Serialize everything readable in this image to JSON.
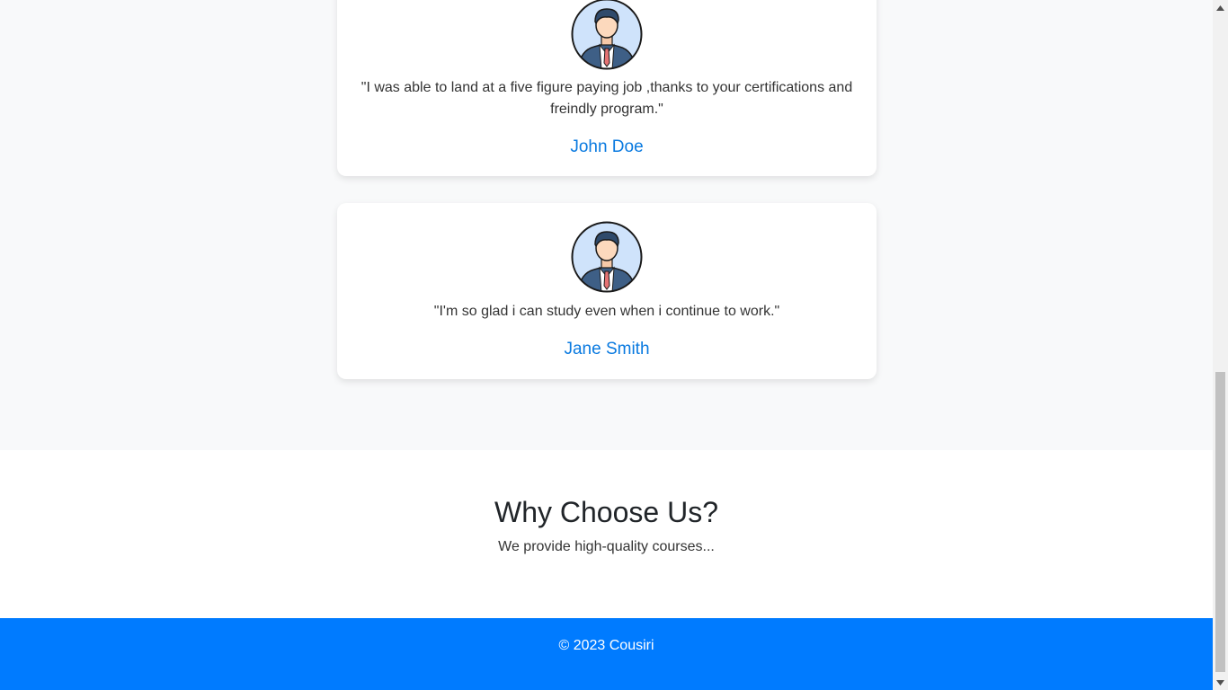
{
  "testimonials": [
    {
      "quote": "\"I was able to land at a five figure paying job ,thanks to your certifications and freindly program.\"",
      "name": "John Doe",
      "avatar_icon": "businessman-avatar-icon"
    },
    {
      "quote": "\"I'm so glad i can study even when i continue to work.\"",
      "name": "Jane Smith",
      "avatar_icon": "businessman-avatar-icon"
    }
  ],
  "why": {
    "title": "Why Choose Us?",
    "text": "We provide high-quality courses..."
  },
  "footer": {
    "text": "© 2023 Cousiri"
  },
  "colors": {
    "accent": "#007bff",
    "name_link": "#0a7ae0",
    "page_bg": "#f8f9fa"
  }
}
